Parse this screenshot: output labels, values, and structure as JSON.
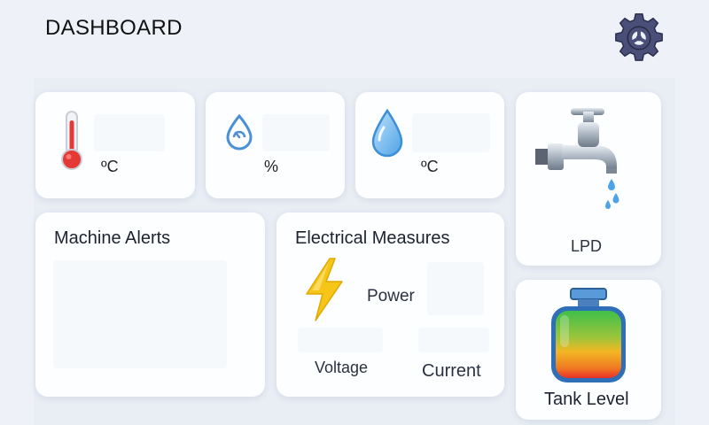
{
  "header": {
    "title": "DASHBOARD",
    "settings_icon": "gear-icon"
  },
  "sensors": [
    {
      "icon": "thermometer-icon",
      "unit": "ºC"
    },
    {
      "icon": "humidity-icon",
      "unit": "%"
    },
    {
      "icon": "water-drop-icon",
      "unit": "ºC"
    }
  ],
  "water_flow": {
    "icon": "faucet-icon",
    "unit": "LPD"
  },
  "machine_alerts": {
    "title": "Machine Alerts"
  },
  "electrical": {
    "title": "Electrical Measures",
    "icon": "lightning-icon",
    "power_label": "Power",
    "voltage_label": "Voltage",
    "current_label": "Current"
  },
  "tank": {
    "icon": "tank-icon",
    "label": "Tank Level"
  },
  "colors": {
    "background": "#eef2f8",
    "card": "#fdfeff",
    "accent_blue": "#4a90d9",
    "gear": "#4a4f7a",
    "thermometer_red": "#e53935",
    "bolt_yellow": "#f5c518",
    "tank_gradient": [
      "#3fbf4a",
      "#f2b824",
      "#e8302a"
    ]
  }
}
